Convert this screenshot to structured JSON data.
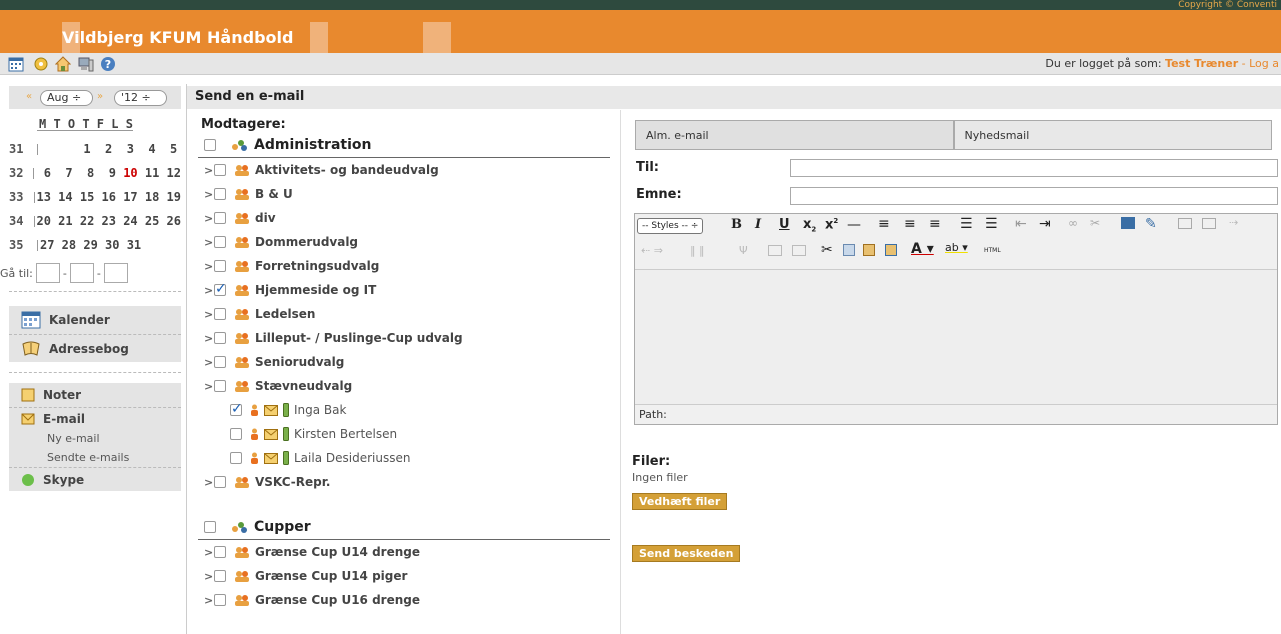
{
  "header": {
    "copyright": "Copyright © Conventi",
    "app_title": "Vildbjerg KFUM Håndbold",
    "login_prefix": "Du er logget på som: ",
    "user": "Test Træner",
    "logout": " - Log a"
  },
  "toolbar": {
    "icons": [
      "calendar-icon",
      "gear-icon",
      "home-icon",
      "computer-icon",
      "help-icon"
    ]
  },
  "sidebar": {
    "month": "Aug",
    "year": "'12",
    "weekdays": "M T O T F L S",
    "weeks": [
      {
        "wk": "31",
        "days": "      1  2  3  4  5"
      },
      {
        "wk": "32",
        "days": " 6  7  8  9 ",
        "today": "10",
        "rest": " 11 12"
      },
      {
        "wk": "33",
        "days": "13 14 15 16 17 18 19"
      },
      {
        "wk": "34",
        "days": "20 21 22 23 24 25 26"
      },
      {
        "wk": "35",
        "days": "27 28 29 30 31"
      }
    ],
    "goto_label": "Gå til:",
    "goto_sep": "-",
    "calendar": "Kalender",
    "addressbook": "Adressebog",
    "notes": "Noter",
    "email": "E-mail",
    "new_email": "Ny e-mail",
    "sent_emails": "Sendte e-mails",
    "skype": "Skype"
  },
  "main": {
    "title": "Send en e-mail",
    "recipients_label": "Modtagere:",
    "group1": "Administration",
    "items": [
      {
        "label": "Aktivitets- og bandeudvalg",
        "checked": false
      },
      {
        "label": "B & U",
        "checked": false
      },
      {
        "label": "div",
        "checked": false
      },
      {
        "label": "Dommerudvalg",
        "checked": false
      },
      {
        "label": "Forretningsudvalg",
        "checked": false
      },
      {
        "label": "Hjemmeside og IT",
        "checked": true
      },
      {
        "label": "Ledelsen",
        "checked": false
      },
      {
        "label": "Lilleput- / Puslinge-Cup udvalg",
        "checked": false
      },
      {
        "label": "Seniorudvalg",
        "checked": false
      },
      {
        "label": "Stævneudvalg",
        "checked": false
      }
    ],
    "persons": [
      {
        "name": "Inga Bak",
        "checked": true
      },
      {
        "name": "Kirsten Bertelsen",
        "checked": false
      },
      {
        "name": "Laila Desideriussen",
        "checked": false
      }
    ],
    "vskc": "VSKC-Repr.",
    "group2": "Cupper",
    "cup_items": [
      "Grænse Cup U14 drenge",
      "Grænse Cup U14 piger",
      "Grænse Cup U16 drenge"
    ],
    "tab_alm": "Alm. e-mail",
    "tab_nyheds": "Nyhedsmail",
    "til_label": "Til:",
    "emne_label": "Emne:",
    "styles_label": "-- Styles --",
    "path_label": "Path:",
    "files_label": "Filer:",
    "no_files": "Ingen filer",
    "attach_button": "Vedhæft filer",
    "send_button": "Send beskeden"
  },
  "colors": {
    "brand": "#e8892e",
    "topbar": "#2e4a3e",
    "button": "#d4a037"
  }
}
